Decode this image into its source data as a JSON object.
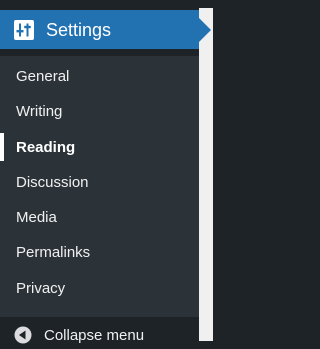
{
  "menu": {
    "header": {
      "label": "Settings",
      "icon": "settings-sliders-icon",
      "color": "#2271b1"
    },
    "items": [
      {
        "label": "General",
        "active": false
      },
      {
        "label": "Writing",
        "active": false
      },
      {
        "label": "Reading",
        "active": true
      },
      {
        "label": "Discussion",
        "active": false
      },
      {
        "label": "Media",
        "active": false
      },
      {
        "label": "Permalinks",
        "active": false
      },
      {
        "label": "Privacy",
        "active": false
      }
    ],
    "collapse": {
      "label": "Collapse menu",
      "icon": "collapse-arrow-icon"
    }
  },
  "colors": {
    "background": "#1d2327",
    "submenu": "#2c3338",
    "accent": "#2271b1",
    "text": "#f0f0f1"
  }
}
